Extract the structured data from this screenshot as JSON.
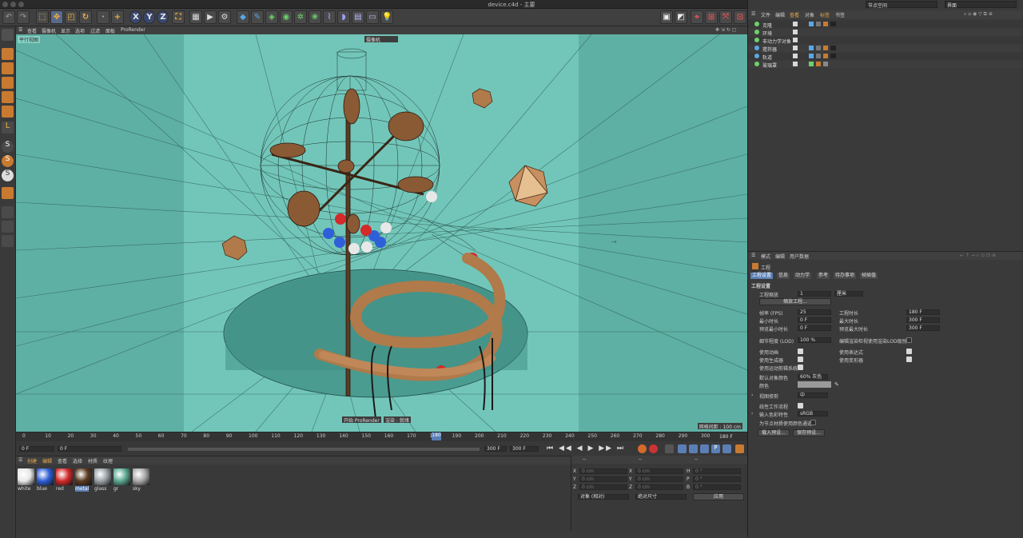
{
  "window": {
    "title": "device.c4d - 主要"
  },
  "top_right": {
    "node_space": "节点空间",
    "interface": "界面"
  },
  "viewport": {
    "menu": [
      "查看",
      "摄像机",
      "显示",
      "选项",
      "过滤",
      "面板",
      "ProRender"
    ],
    "label_parallel": "平行视图",
    "camera_dropdown": "摄像机",
    "render_start": "开始 ProRender",
    "render_stop": "渲染 : 就绪",
    "grid_spacing": "网格间距 : 100 cm",
    "bg_color": "#6fc4b8"
  },
  "timeline": {
    "ticks": [
      "0",
      "10",
      "20",
      "30",
      "40",
      "50",
      "60",
      "70",
      "80",
      "90",
      "100",
      "110",
      "120",
      "130",
      "140",
      "150",
      "160",
      "170",
      "180",
      "190",
      "200",
      "210",
      "220",
      "230",
      "240",
      "250",
      "260",
      "270",
      "280",
      "290",
      "300"
    ],
    "current_marker": "180",
    "end_frame": "180 F",
    "start_field": "0 F",
    "min_field": "0 F",
    "max_field": "300 F",
    "max_field2": "300 F"
  },
  "material_manager": {
    "menu": [
      "创建",
      "编辑",
      "查看",
      "选择",
      "材质",
      "纹理"
    ],
    "materials": [
      {
        "name": "white",
        "color": "#e8e8e8"
      },
      {
        "name": "blue",
        "color": "#2f5fd8"
      },
      {
        "name": "red",
        "color": "#d32a2a"
      },
      {
        "name": "metal",
        "color": "#5a3a22"
      },
      {
        "name": "glass",
        "color": "#9aa3a8"
      },
      {
        "name": "gr",
        "color": "#5aa891"
      },
      {
        "name": "sky",
        "color": "#a9a9a9"
      }
    ]
  },
  "coordinates": {
    "header": [
      "--",
      "--",
      "--"
    ],
    "rows": [
      {
        "axis": "X",
        "pos": "0 cm",
        "axis2": "X",
        "size": "0 cm",
        "axis3": "H",
        "rot": "0 °"
      },
      {
        "axis": "Y",
        "pos": "0 cm",
        "axis2": "Y",
        "size": "0 cm",
        "axis3": "P",
        "rot": "0 °"
      },
      {
        "axis": "Z",
        "pos": "0 cm",
        "axis2": "Z",
        "size": "0 cm",
        "axis3": "B",
        "rot": "0 °"
      }
    ],
    "mode": "对象 (相对)",
    "size_mode": "绝对尺寸",
    "apply": "应用"
  },
  "object_manager": {
    "menu": [
      "文件",
      "编辑",
      "查看",
      "对象",
      "标签",
      "书签"
    ],
    "objects": [
      {
        "name": "克隆"
      },
      {
        "name": "环境"
      },
      {
        "name": "非动力学对象"
      },
      {
        "name": "搅拌器"
      },
      {
        "name": "轨道"
      },
      {
        "name": "玻璃罩"
      }
    ]
  },
  "attributes": {
    "menu": [
      "模式",
      "编辑",
      "用户数据"
    ],
    "object_label": "工程",
    "tabs": [
      "工程设置",
      "信息",
      "动力学",
      "参考",
      "待办事项",
      "帧插值"
    ],
    "section": "工程设置",
    "project_scale_label": "工程缩放",
    "project_scale_value": "1",
    "project_scale_unit": "厘米",
    "scale_button": "缩放工程...",
    "fps_label": "帧率 (FPS)",
    "fps_value": "25",
    "min_time_label": "最小时长",
    "min_time_value": "0 F",
    "preview_min_label": "预览最小时长",
    "preview_min_value": "0 F",
    "duration_label": "工程时长",
    "duration_value": "180 F",
    "max_time_label": "最大时长",
    "max_time_value": "300 F",
    "preview_max_label": "预览最大时长",
    "preview_max_value": "300 F",
    "lod_label": "细节程度 (LOD)",
    "lod_value": "100 %",
    "render_lod_label": "编辑渲染检视使用渲染LOD级别",
    "use_anim": "使用动画",
    "use_expr": "使用表达式",
    "use_gen": "使用生成器",
    "use_deform": "使用变形器",
    "use_motion": "使用运动剪辑系统",
    "default_color_label": "默认对象颜色",
    "default_color_value": "60% 灰色",
    "color_label": "颜色",
    "view_clip_label": "视图修剪",
    "view_clip_value": "中",
    "linear_label": "线性工作流程",
    "input_color_label": "输入色彩特性",
    "input_color_value": "sRGB",
    "node_color_label": "为节点材质使用颜色通道",
    "load_preset": "载入预设...",
    "save_preset": "保存预设..."
  }
}
